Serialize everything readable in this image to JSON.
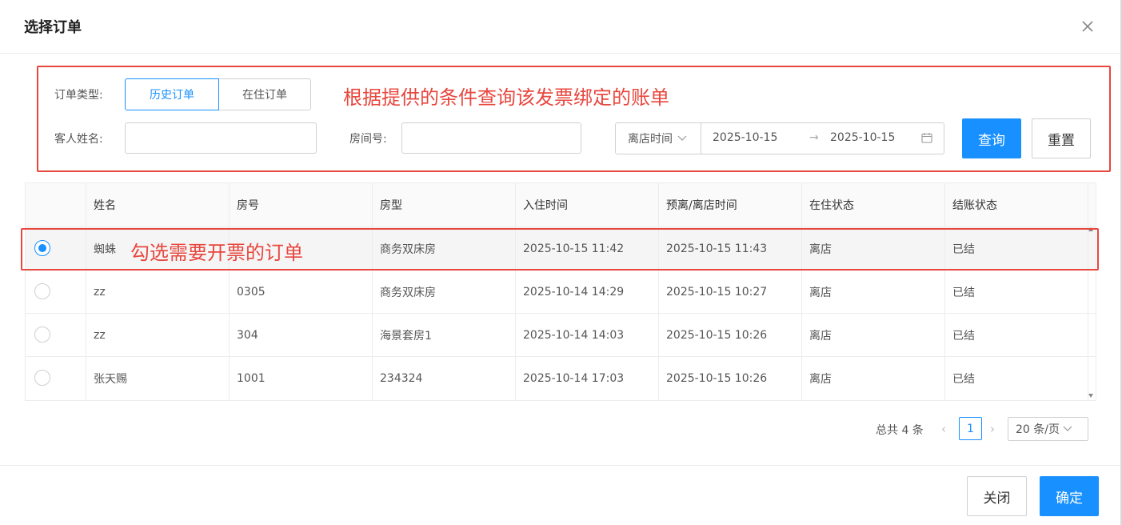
{
  "dialog": {
    "title": "选择订单"
  },
  "filters": {
    "order_type_label": "订单类型:",
    "order_type_options": [
      "历史订单",
      "在住订单"
    ],
    "guest_name_label": "客人姓名:",
    "guest_name_value": "",
    "room_no_label": "房间号:",
    "room_no_value": "",
    "date_type": "离店时间",
    "date_start": "2025-10-15",
    "date_separator": "→",
    "date_end": "2025-10-15",
    "query_button": "查询",
    "reset_button": "重置"
  },
  "annotations": {
    "filter_note": "根据提供的条件查询该发票绑定的账单",
    "row_note": "勾选需要开票的订单"
  },
  "table": {
    "columns": [
      "",
      "姓名",
      "房号",
      "房型",
      "入住时间",
      "预离/离店时间",
      "在住状态",
      "结账状态"
    ],
    "rows": [
      {
        "selected": true,
        "name": "蜘蛛",
        "room": "",
        "room_type": "商务双床房",
        "checkin": "2025-10-15 11:42",
        "checkout": "2025-10-15 11:43",
        "stay_status": "离店",
        "bill_status": "已结"
      },
      {
        "selected": false,
        "name": "zz",
        "room": "0305",
        "room_type": "商务双床房",
        "checkin": "2025-10-14 14:29",
        "checkout": "2025-10-15 10:27",
        "stay_status": "离店",
        "bill_status": "已结"
      },
      {
        "selected": false,
        "name": "zz",
        "room": "304",
        "room_type": "海景套房1",
        "checkin": "2025-10-14 14:03",
        "checkout": "2025-10-15 10:26",
        "stay_status": "离店",
        "bill_status": "已结"
      },
      {
        "selected": false,
        "name": "张天赐",
        "room": "1001",
        "room_type": "234324",
        "checkin": "2025-10-14 17:03",
        "checkout": "2025-10-15 10:26",
        "stay_status": "离店",
        "bill_status": "已结"
      }
    ]
  },
  "pagination": {
    "total_text": "总共 4 条",
    "prev": "‹",
    "current_page": "1",
    "next": "›",
    "page_size": "20 条/页"
  },
  "footer": {
    "close_button": "关闭",
    "confirm_button": "确定"
  },
  "colors": {
    "accent": "#1890ff",
    "annotation": "#e8473e"
  },
  "icons": [
    "close-icon",
    "chevron-down-icon",
    "calendar-icon",
    "arrow-right-icon",
    "scroll-up-icon",
    "scroll-down-icon"
  ]
}
